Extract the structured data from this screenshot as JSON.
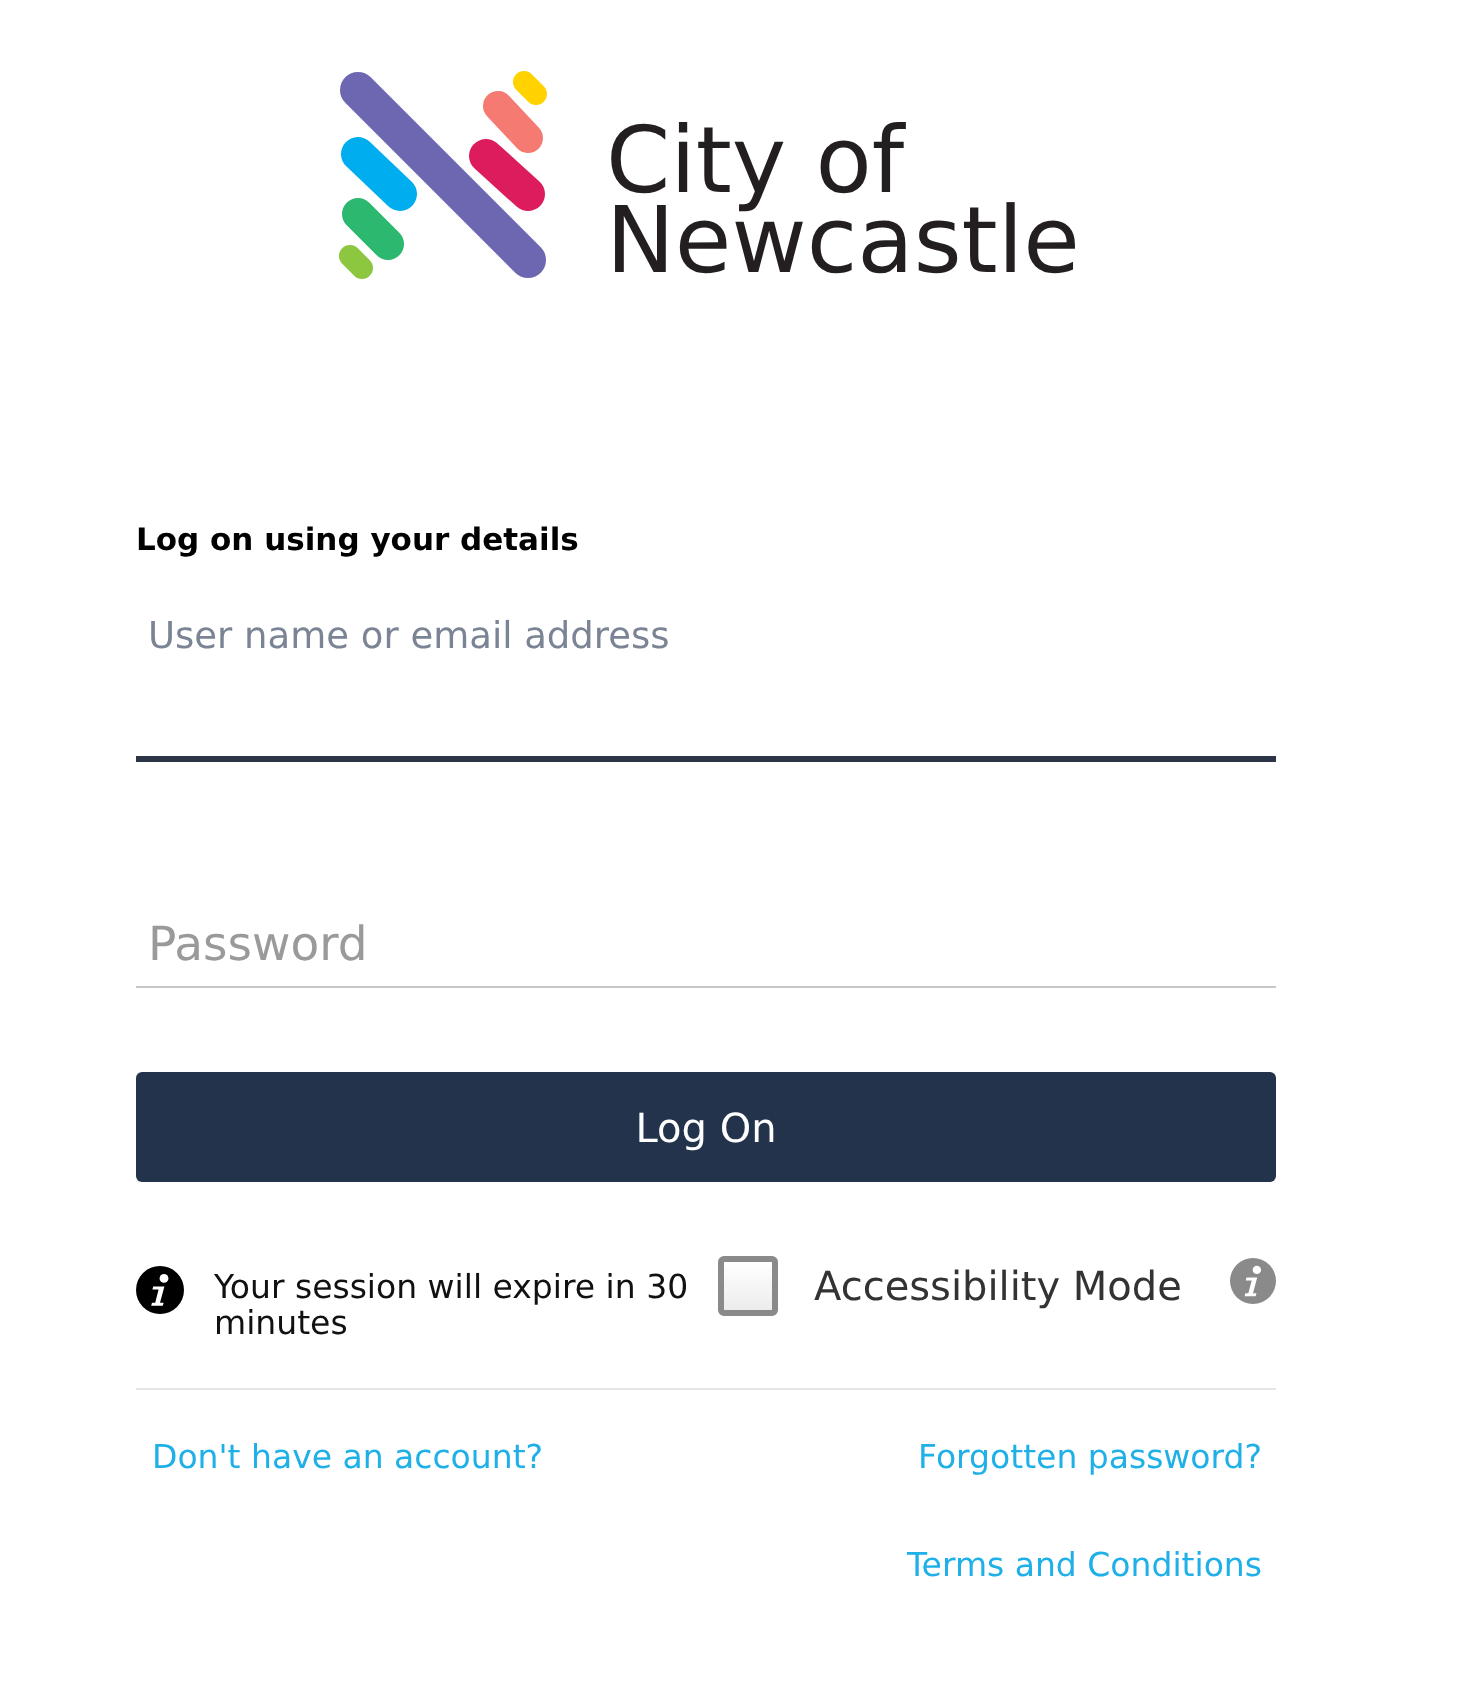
{
  "logo": {
    "wordmark": "City of Newcastle"
  },
  "form": {
    "heading": "Log on using your details",
    "fields": [
      {
        "placeholder": "User name or email address",
        "focused": true
      },
      {
        "placeholder": "Password",
        "focused": false
      }
    ],
    "submit_button": "Log On",
    "session_notice": "Your session will expire in 30 minutes",
    "accessibility_mode": {
      "label": "Accessibility Mode",
      "checked": false
    }
  },
  "link_rows": [
    [
      "Don't have an account?",
      "Forgotten password?"
    ],
    [
      "Terms and Conditions"
    ]
  ]
}
